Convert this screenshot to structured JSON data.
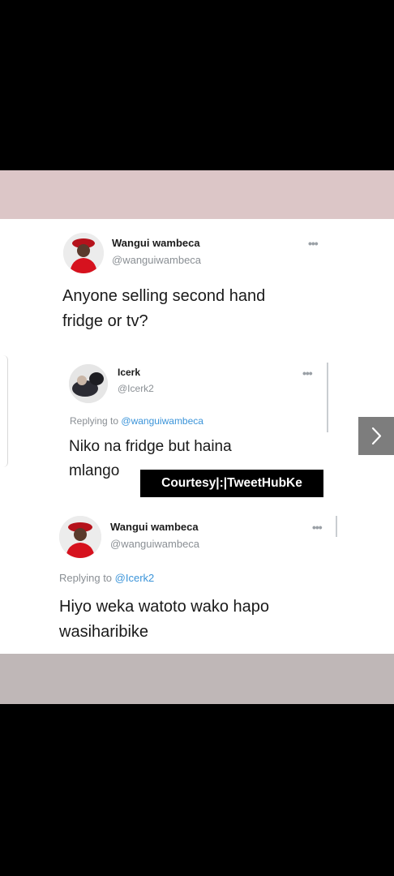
{
  "tweet1": {
    "name": "Wangui wambeca",
    "handle": "@wanguiwambeca",
    "text_line1": "Anyone selling second hand",
    "text_line2": "fridge or tv?"
  },
  "tweet2": {
    "name": "Icerk",
    "handle": "@Icerk2",
    "replying_prefix": "Replying to",
    "replying_to": "@wanguiwambeca",
    "text_line1": "Niko na fridge but haina",
    "text_line2": "mlango"
  },
  "tweet3": {
    "name": "Wangui wambeca",
    "handle": "@wanguiwambeca",
    "replying_prefix": "Replying to",
    "replying_to": "@Icerk2",
    "text_line1": "Hiyo weka watoto wako hapo",
    "text_line2": "wasiharibike"
  },
  "watermark": "Courtesy|:|TweetHubKe",
  "more_glyph": "•••",
  "next_glyph": "›",
  "colors": {
    "top_band": "#dcc6c7",
    "bottom_band": "#bfb7b7",
    "link": "#3b94d9",
    "next_button": "#7d7d7d"
  },
  "icons": {
    "more": "more-horizontal-icon",
    "next": "chevron-right-icon"
  }
}
